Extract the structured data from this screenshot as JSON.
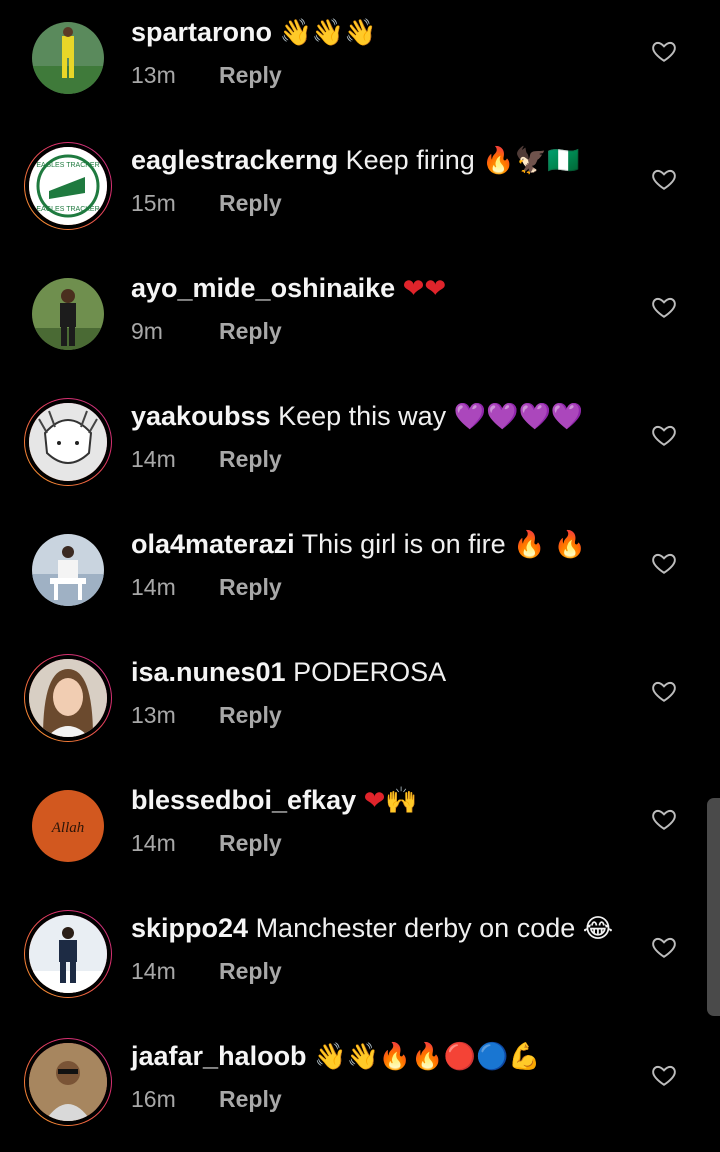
{
  "comments": [
    {
      "username": "spartarono",
      "message": "",
      "emoji": "👋👋👋",
      "time": "13m",
      "reply": "Reply"
    },
    {
      "username": "eaglestrackerng",
      "message": "Keep firing",
      "emoji": "🔥🦅🇳🇬",
      "time": "15m",
      "reply": "Reply"
    },
    {
      "username": "ayo_mide_oshinaike",
      "message": "",
      "emoji": "❤❤",
      "time": "9m",
      "reply": "Reply"
    },
    {
      "username": "yaakoubss",
      "message": "Keep this way",
      "emoji": "💜💜💜💜",
      "time": "14m",
      "reply": "Reply"
    },
    {
      "username": "ola4materazi",
      "message": "This girl is on fire",
      "emoji": "🔥 🔥",
      "time": "14m",
      "reply": "Reply"
    },
    {
      "username": "isa.nunes01",
      "message": "PODEROSA",
      "emoji": "",
      "time": "13m",
      "reply": "Reply"
    },
    {
      "username": "blessedboi_efkay",
      "message": "",
      "emoji": "❤🙌",
      "time": "14m",
      "reply": "Reply"
    },
    {
      "username": "skippo24",
      "message": "Manchester derby on code",
      "emoji": "😂",
      "time": "14m",
      "reply": "Reply"
    },
    {
      "username": "jaafar_haloob",
      "message": "",
      "emoji": "👋👋🔥🔥🔴🔵💪",
      "time": "16m",
      "reply": "Reply"
    }
  ],
  "avatars": {
    "eagles_logo_top": "EAGLES TRACKER",
    "eagles_logo_bottom": "EAGLES TRACKER",
    "blessed_avatar_text": "Allah"
  },
  "colors": {
    "background": "#000000",
    "text": "#f5f5f5",
    "meta": "#a8a8a8",
    "story_ring_start": "#f9a12e",
    "story_ring_end": "#c13584"
  }
}
